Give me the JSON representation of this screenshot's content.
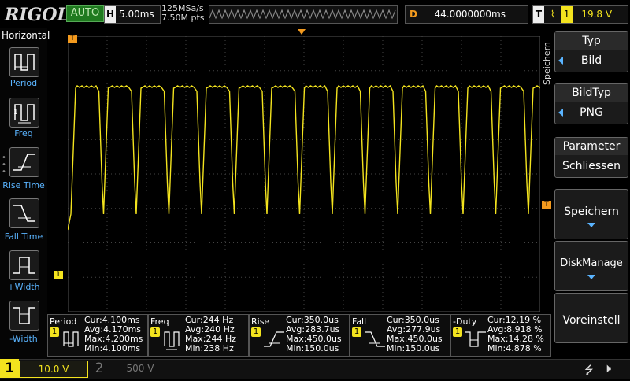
{
  "topbar": {
    "logo": "RIGOL",
    "mode": "AUTO",
    "timebase_label": "H",
    "timebase_value": "5.00ms",
    "sample_rate": "125MSa/s",
    "memory_depth": "7.50M pts",
    "delay_label": "D",
    "delay_value": "44.0000000ms",
    "trigger_label": "T",
    "trigger_edge": "rising-edge-icon",
    "trigger_channel": "1",
    "trigger_level": "19.8 V"
  },
  "left_panel": {
    "title": "Horizontal",
    "items": [
      {
        "label": "Period",
        "icon": "period-icon"
      },
      {
        "label": "Freq",
        "icon": "freq-icon"
      },
      {
        "label": "Rise Time",
        "icon": "rise-time-icon"
      },
      {
        "label": "Fall Time",
        "icon": "fall-time-icon"
      },
      {
        "label": "+Width",
        "icon": "pos-width-icon"
      },
      {
        "label": "-Width",
        "icon": "neg-width-icon"
      }
    ]
  },
  "right_panel": {
    "side_label": "Speichern",
    "items": [
      {
        "title": "Typ",
        "value": "Bild"
      },
      {
        "title": "BildTyp",
        "value": "PNG"
      },
      {
        "title": "Parameter",
        "value": "Schliessen"
      },
      {
        "label": "Speichern"
      },
      {
        "label": "DiskManage"
      },
      {
        "label": "Voreinstell"
      }
    ]
  },
  "markers": {
    "trigger_pos": "T",
    "ch1_marker": "1"
  },
  "measurements": [
    {
      "name": "Period",
      "cur": "Cur:4.100ms",
      "avg": "Avg:4.170ms",
      "max": "Max:4.200ms",
      "min": "Min:4.100ms",
      "icon": "period-icon"
    },
    {
      "name": "Freq",
      "cur": "Cur:244 Hz",
      "avg": "Avg:240 Hz",
      "max": "Max:244 Hz",
      "min": "Min:238 Hz",
      "icon": "freq-icon"
    },
    {
      "name": "Rise",
      "cur": "Cur:350.0us",
      "avg": "Avg:283.7us",
      "max": "Max:450.0us",
      "min": "Min:150.0us",
      "icon": "rise-time-icon"
    },
    {
      "name": "Fall",
      "cur": "Cur:350.0us",
      "avg": "Avg:277.9us",
      "max": "Max:450.0us",
      "min": "Min:150.0us",
      "icon": "fall-time-icon"
    },
    {
      "name": "-Duty",
      "cur": "Cur:12.19 %",
      "avg": "Avg:8.918 %",
      "max": "Max:14.28 %",
      "min": "Min:4.878 %",
      "icon": "neg-duty-icon"
    }
  ],
  "bottombar": {
    "ch1_number": "1",
    "ch1_scale": "10.0 V",
    "ch2_number": "2",
    "ch2_scale": "500 V"
  },
  "colors": {
    "ch1": "#f3e31e",
    "accent": "#5ab4ff",
    "trigger_marker": "#f39a1e",
    "mode_auto": "#1f7a1f"
  }
}
